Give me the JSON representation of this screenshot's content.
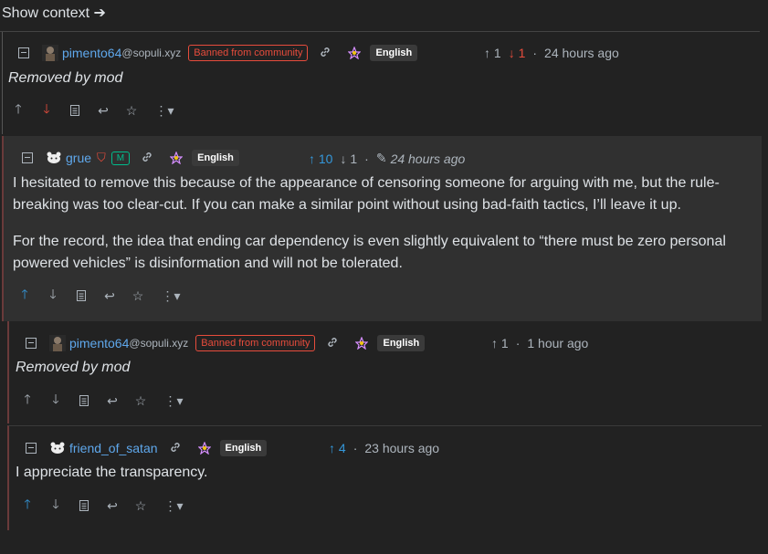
{
  "show_context": "Show context ➔",
  "comments": [
    {
      "username": "pimento64",
      "instance": "@sopuli.xyz",
      "banned": "Banned from community",
      "language": "English",
      "upvotes": "1",
      "downvotes": "1",
      "time": "24 hours ago",
      "body": "Removed by mod"
    },
    {
      "username": "grue",
      "mod_badge": "M",
      "language": "English",
      "upvotes": "10",
      "downvotes": "1",
      "time": "24 hours ago",
      "paragraph1": "I hesitated to remove this because of the appearance of censoring someone for arguing with me, but the rule-breaking was too clear-cut. If you can make a similar point without using bad-faith tactics, I’ll leave it up.",
      "paragraph2": "For the record, the idea that ending car dependency is even slightly equivalent to “there must be zero personal powered vehicles” is disinformation and will not be tolerated."
    },
    {
      "username": "pimento64",
      "instance": "@sopuli.xyz",
      "banned": "Banned from community",
      "language": "English",
      "upvotes": "1",
      "time": "1 hour ago",
      "body": "Removed by mod"
    },
    {
      "username": "friend_of_satan",
      "language": "English",
      "upvotes": "4",
      "time": "23 hours ago",
      "body": "I appreciate the transparency."
    }
  ],
  "colors": {
    "accent": "#3498db",
    "danger": "#e74c3c",
    "mod": "#00bc8c",
    "link": "#5fa8ec"
  }
}
